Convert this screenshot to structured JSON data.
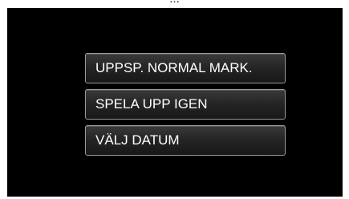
{
  "caption": "...",
  "menu": {
    "items": [
      {
        "label": "UPPSP. NORMAL MARK."
      },
      {
        "label": "SPELA UPP IGEN"
      },
      {
        "label": "VÄLJ DATUM"
      }
    ]
  }
}
